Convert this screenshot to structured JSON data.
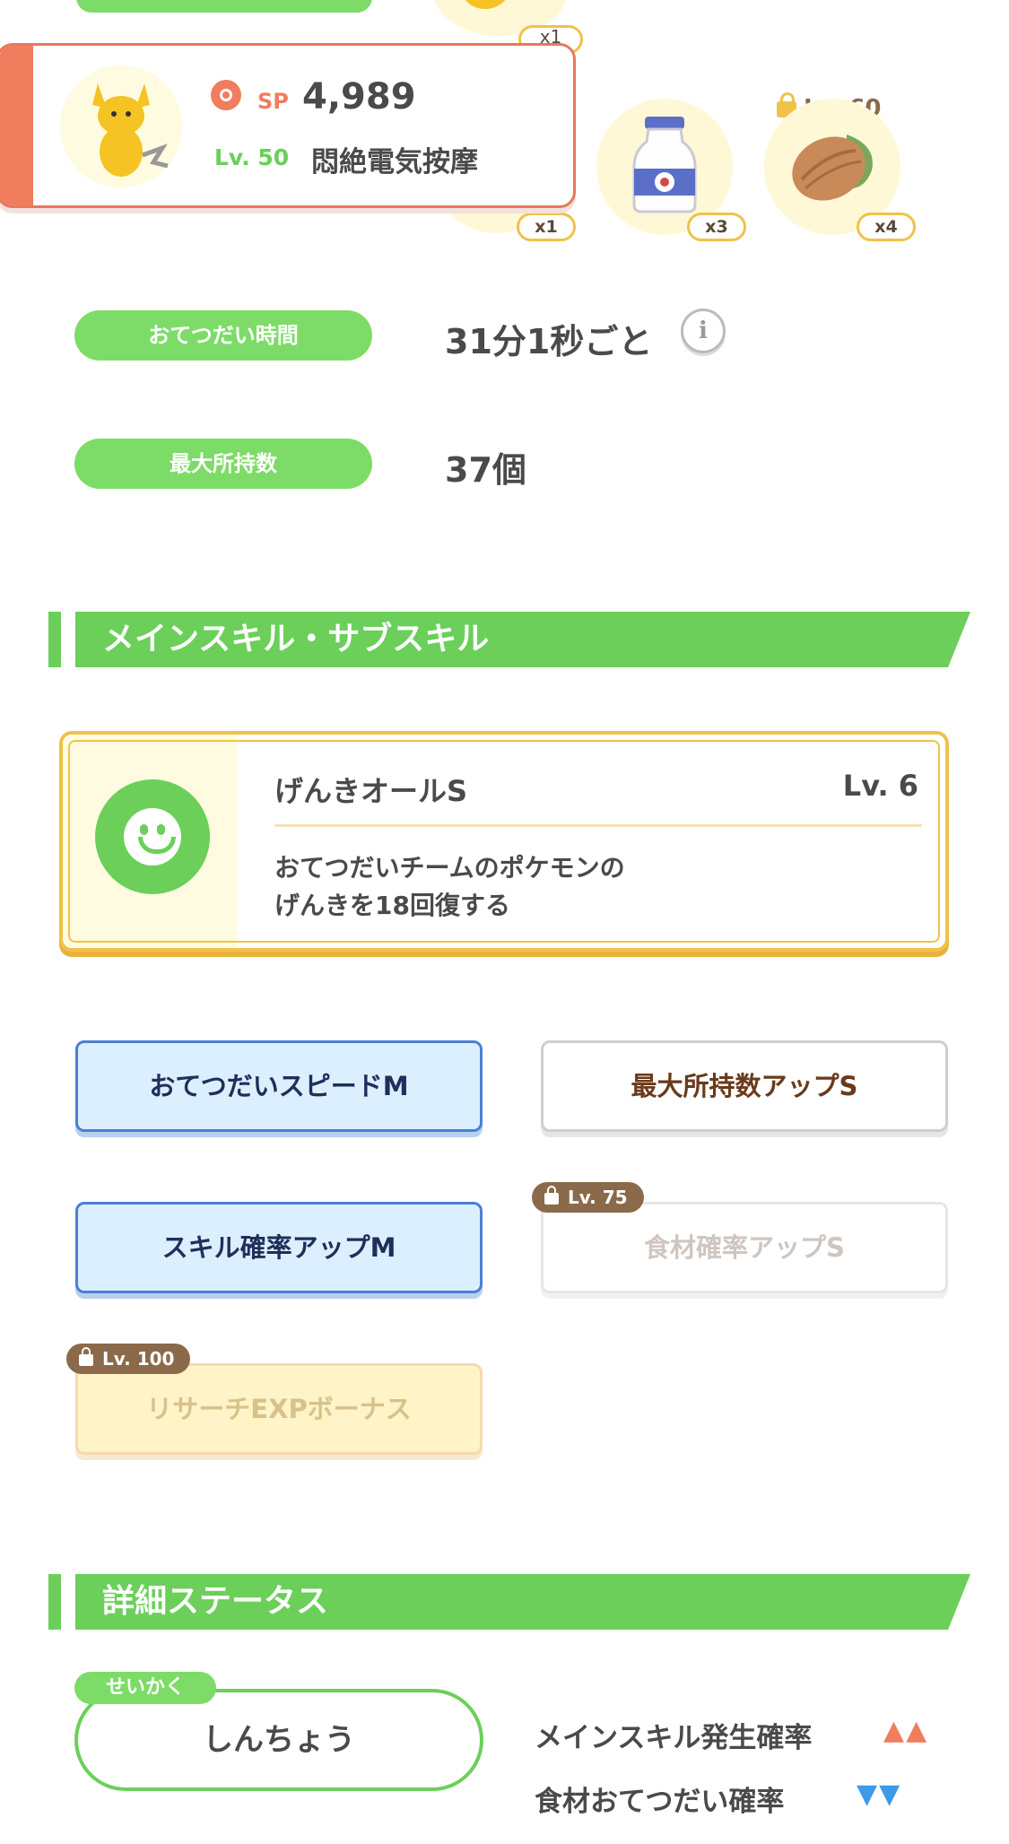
{
  "top": {
    "partial_badge": "x1",
    "pokemon_card": {
      "sp_label": "SP",
      "sp_value": "4,989",
      "level_label": "Lv. 50",
      "skill_name": "悶絶電気按摩"
    },
    "ingredients": [
      {
        "icon": "ingredient-icon",
        "count": "x1"
      },
      {
        "icon": "milk-bottle-icon",
        "count": "x3"
      },
      {
        "icon": "cacao-icon",
        "count": "x4",
        "lock_level": "Lv. 60"
      }
    ]
  },
  "stats": [
    {
      "label": "おてつだい時間",
      "value": "31分1秒ごと"
    },
    {
      "label": "最大所持数",
      "value": "37個"
    }
  ],
  "skills_section": {
    "title": "メインスキル・サブスキル",
    "main_skill": {
      "name": "げんきオールS",
      "level": "Lv. 6",
      "description_line1": "おてつだいチームのポケモンの",
      "description_line2": "げんきを18回復する"
    },
    "sub_skills": [
      {
        "label": "おてつだいスピードM",
        "style": "blue"
      },
      {
        "label": "最大所持数アップS",
        "style": "white"
      },
      {
        "label": "スキル確率アップM",
        "style": "blue"
      },
      {
        "label": "食材確率アップS",
        "style": "locked",
        "lock_level": "Lv. 75"
      },
      {
        "label": "リサーチEXPボーナス",
        "style": "locked-gold",
        "lock_level": "Lv. 100"
      }
    ]
  },
  "details_section": {
    "title": "詳細ステータス",
    "nature_tag": "せいかく",
    "nature_value": "しんちょう",
    "effects": [
      {
        "label": "メインスキル発生確率",
        "arrows": "▲▲",
        "direction": "up"
      },
      {
        "label": "食材おてつだい確率",
        "arrows": "▼▼",
        "direction": "down"
      }
    ]
  },
  "colors": {
    "accent_green": "#6bcf5a",
    "pill_green": "#7ddc67",
    "card_orange": "#ef7d5e",
    "gold": "#f0c24a",
    "up_arrow": "#ef7d5e",
    "down_arrow": "#3d9ae8"
  }
}
